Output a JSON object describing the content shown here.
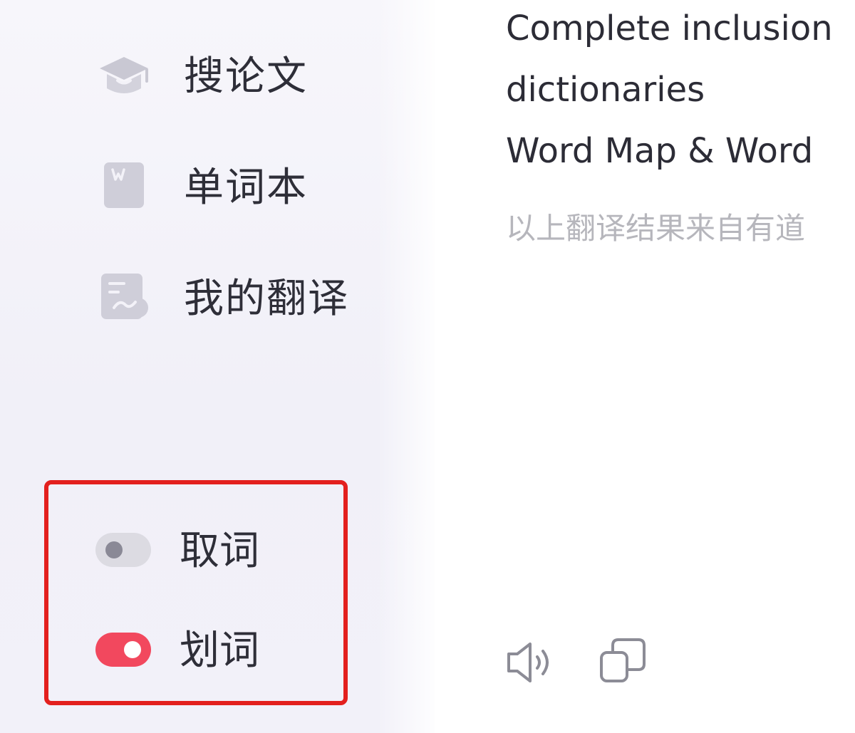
{
  "sidebar": {
    "items": [
      {
        "label": "搜论文",
        "icon": "graduation-cap-icon"
      },
      {
        "label": "单词本",
        "icon": "wordbook-icon"
      },
      {
        "label": "我的翻译",
        "icon": "translation-doc-icon"
      }
    ],
    "toggles": [
      {
        "label": "取词",
        "state": "off"
      },
      {
        "label": "划词",
        "state": "on"
      }
    ]
  },
  "main": {
    "result_lines": [
      "Complete inclusion",
      "dictionaries",
      "Word Map & Word"
    ],
    "source_note": "以上翻译结果来自有道",
    "actions": [
      {
        "icon": "speaker-icon"
      },
      {
        "icon": "copy-icon"
      }
    ]
  },
  "colors": {
    "accent": "#f2485e",
    "highlight_border": "#e3201e",
    "icon_gray": "#c9c8d3"
  }
}
